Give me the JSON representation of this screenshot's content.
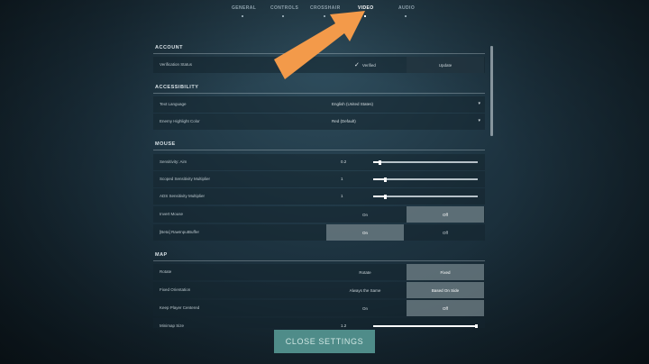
{
  "tabs": [
    {
      "label": "GENERAL",
      "active": false
    },
    {
      "label": "CONTROLS",
      "active": false
    },
    {
      "label": "CROSSHAIR",
      "active": false
    },
    {
      "label": "VIDEO",
      "active": true
    },
    {
      "label": "AUDIO",
      "active": false
    }
  ],
  "sections": {
    "account": {
      "title": "ACCOUNT",
      "verification": {
        "label": "Verification Status",
        "option_a": "Verified",
        "option_b": "Update"
      }
    },
    "accessibility": {
      "title": "ACCESSIBILITY",
      "text_language": {
        "label": "Text Language",
        "value": "English (United States)"
      },
      "enemy_highlight": {
        "label": "Enemy Highlight Color",
        "value": "Red (Default)"
      }
    },
    "mouse": {
      "title": "MOUSE",
      "sensitivity_aim": {
        "label": "Sensitivity: Aim",
        "value": "0.2",
        "fraction": 0.05
      },
      "scoped_sensitivity": {
        "label": "Scoped Sensitivity Multiplier",
        "value": "1",
        "fraction": 0.1
      },
      "ads_sensitivity": {
        "label": "ADS Sensitivity Multiplier",
        "value": "1",
        "fraction": 0.1
      },
      "invert_mouse": {
        "label": "Invert Mouse",
        "on": "On",
        "off": "Off",
        "selected": "off"
      },
      "raw_input": {
        "label": "[Beta] RawInputBuffer",
        "on": "On",
        "off": "Off",
        "selected": "on"
      }
    },
    "map": {
      "title": "MAP",
      "rotate": {
        "label": "Rotate",
        "option_a": "Rotate",
        "option_b": "Fixed",
        "selected": "b"
      },
      "fixed_orientation": {
        "label": "Fixed Orientation",
        "option_a": "Always the Same",
        "option_b": "Based On Side",
        "selected": "b"
      },
      "keep_player_centered": {
        "label": "Keep Player Centered",
        "on": "On",
        "off": "Off",
        "selected": "off"
      },
      "minimap_size": {
        "label": "Minimap Size",
        "value": "1.2",
        "fraction": 1.0
      }
    }
  },
  "close_button": {
    "label": "CLOSE SETTINGS"
  },
  "icons": {
    "check": "check-icon",
    "caret": "caret-down-icon",
    "arrow": "pointer-arrow"
  },
  "colors": {
    "arrow": "#f39a4a",
    "close_button": "#4f8c89"
  }
}
